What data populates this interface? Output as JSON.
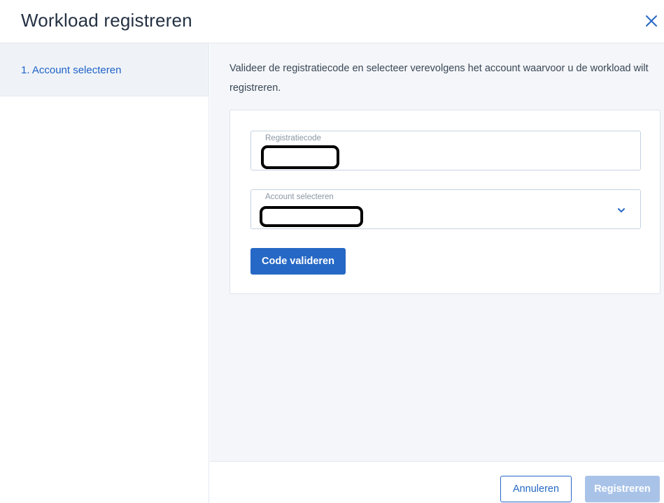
{
  "dialog": {
    "title": "Workload registreren",
    "close_icon": "close-icon"
  },
  "sidebar": {
    "steps": [
      {
        "label": "1. Account selecteren",
        "active": true
      }
    ]
  },
  "main": {
    "instruction": "Valideer de registratiecode en selecteer verevolgens het account waarvoor u de workload wilt registreren.",
    "form": {
      "code_field": {
        "label": "Registratiecode",
        "value": ""
      },
      "account_field": {
        "label": "Account selecteren",
        "value": "",
        "icon": "chevron-down-icon"
      },
      "validate_button": "Code valideren"
    }
  },
  "footer": {
    "cancel_button": "Annuleren",
    "register_button": "Registreren"
  },
  "colors": {
    "accent": "#2668c5",
    "accent_disabled": "#a9c3e8",
    "content_background": "#f4f6f9",
    "active_step_background": "#eff3f8"
  }
}
